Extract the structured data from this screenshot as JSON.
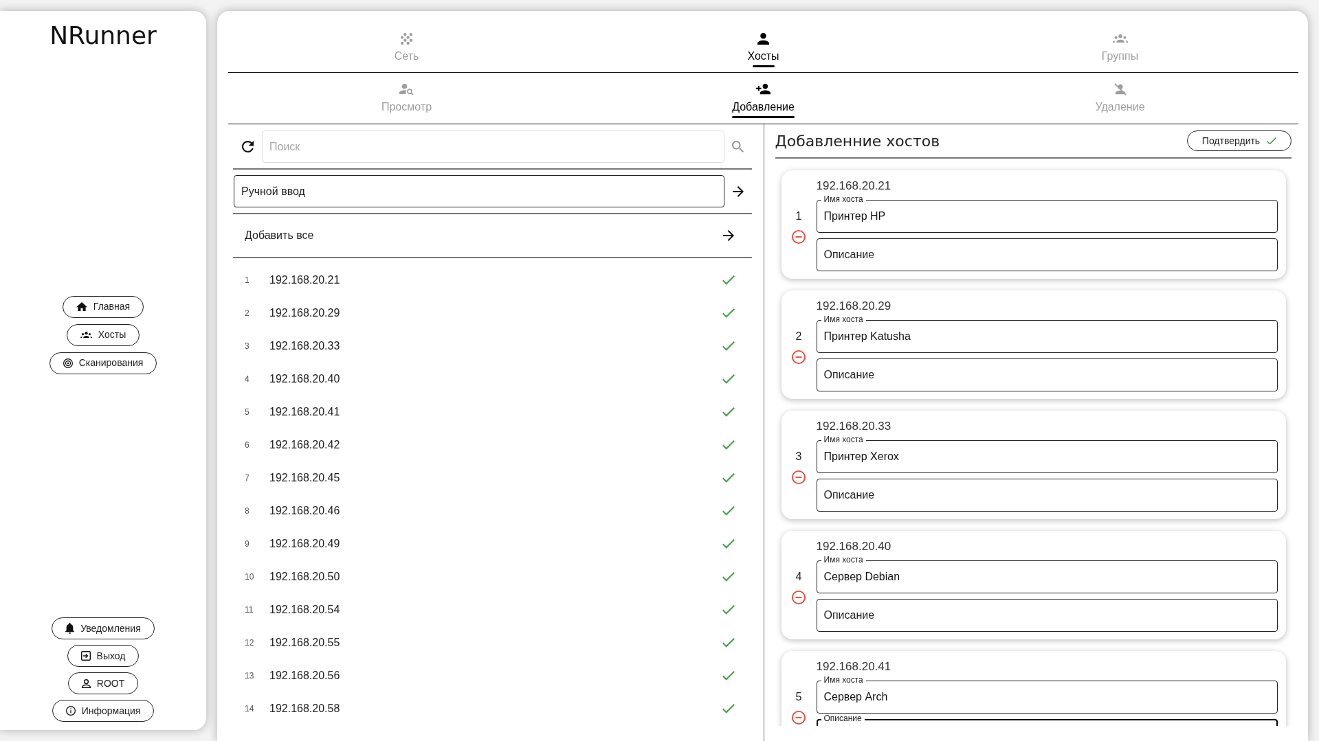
{
  "sidebar": {
    "title": "NRunner",
    "nav_buttons": [
      {
        "label": "Главная"
      },
      {
        "label": "Хосты"
      },
      {
        "label": "Сканирования"
      }
    ],
    "bottom_buttons": [
      {
        "label": "Уведомления"
      },
      {
        "label": "Выход"
      },
      {
        "label": "ROOT"
      },
      {
        "label": "Информация"
      }
    ]
  },
  "tabs": [
    {
      "label": "Сеть",
      "selected": false
    },
    {
      "label": "Хосты",
      "selected": true
    },
    {
      "label": "Группы",
      "selected": false
    }
  ],
  "subtabs": [
    {
      "label": "Просмотр",
      "selected": false
    },
    {
      "label": "Добавление",
      "selected": true
    },
    {
      "label": "Удаление",
      "selected": false
    }
  ],
  "scan_list": {
    "search": {
      "placeholder": "Поиск"
    },
    "manual_input": {
      "placeholder": "Ручной ввод"
    },
    "add_all": "Добавить все",
    "rows": [
      {
        "number": "1",
        "ip": "192.168.20.21",
        "added": true
      },
      {
        "number": "2",
        "ip": "192.168.20.29",
        "added": true
      },
      {
        "number": "3",
        "ip": "192.168.20.33",
        "added": true
      },
      {
        "number": "4",
        "ip": "192.168.20.40",
        "added": true
      },
      {
        "number": "5",
        "ip": "192.168.20.41",
        "added": true
      },
      {
        "number": "6",
        "ip": "192.168.20.42",
        "added": true
      },
      {
        "number": "7",
        "ip": "192.168.20.45",
        "added": true
      },
      {
        "number": "8",
        "ip": "192.168.20.46",
        "added": true
      },
      {
        "number": "9",
        "ip": "192.168.20.49",
        "added": true
      },
      {
        "number": "10",
        "ip": "192.168.20.50",
        "added": true
      },
      {
        "number": "11",
        "ip": "192.168.20.54",
        "added": true
      },
      {
        "number": "12",
        "ip": "192.168.20.55",
        "added": true
      },
      {
        "number": "13",
        "ip": "192.168.20.56",
        "added": true
      },
      {
        "number": "14",
        "ip": "192.168.20.58",
        "added": true
      }
    ]
  },
  "add_panel": {
    "title": "Добавленние хостов",
    "confirm_button": "Подтвердить",
    "hosts": [
      {
        "number": "1",
        "ip": "192.168.20.21",
        "name_field": {
          "label": "Имя хоста",
          "value": "Принтер HP"
        },
        "description_field": {
          "placeholder": "Описание",
          "focused": false
        }
      },
      {
        "number": "2",
        "ip": "192.168.20.29",
        "name_field": {
          "label": "Имя хоста",
          "value": "Принтер Katusha"
        },
        "description_field": {
          "placeholder": "Описание",
          "focused": false
        }
      },
      {
        "number": "3",
        "ip": "192.168.20.33",
        "name_field": {
          "label": "Имя хоста",
          "value": "Принтер Xerox"
        },
        "description_field": {
          "placeholder": "Описание",
          "focused": false
        }
      },
      {
        "number": "4",
        "ip": "192.168.20.40",
        "name_field": {
          "label": "Имя хоста",
          "value": "Сервер Debian"
        },
        "description_field": {
          "placeholder": "Описание",
          "focused": false
        }
      },
      {
        "number": "5",
        "ip": "192.168.20.41",
        "name_field": {
          "label": "Имя хоста",
          "value": "Сервер Arch"
        },
        "description_field": {
          "placeholder": "Описание",
          "focused": true
        }
      }
    ]
  }
}
